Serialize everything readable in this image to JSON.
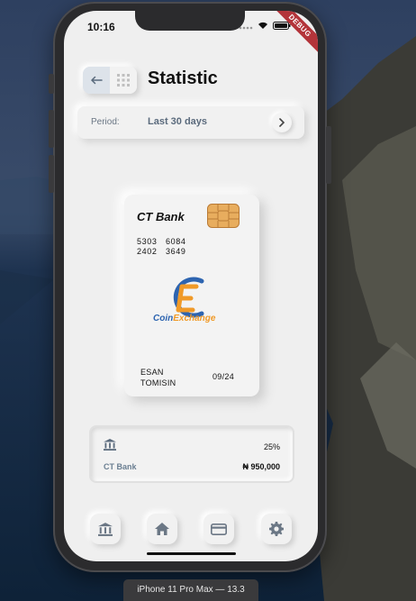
{
  "simulator": {
    "device_label": "iPhone 11 Pro Max — 13.3"
  },
  "status_bar": {
    "time": "10:16",
    "debug_banner": "DEBUG"
  },
  "header": {
    "title": "Statistic",
    "back_icon": "arrow-left-icon",
    "grid_icon": "grid-icon"
  },
  "period": {
    "label": "Period:",
    "value": "Last 30 days"
  },
  "card": {
    "bank_name": "CT Bank",
    "number_rows": [
      [
        "5303",
        "6084"
      ],
      [
        "2402",
        "3649"
      ]
    ],
    "logo_text_part1": "Coin",
    "logo_text_part2": "Exchange",
    "holder_line1": "ESAN",
    "holder_line2": "TOMISIN",
    "expiry": "09/24"
  },
  "summary": {
    "bank_name": "CT Bank",
    "percentage": "25%",
    "amount": "₦ 950,000"
  },
  "bottom_nav": {
    "items": [
      "bank-icon",
      "home-icon",
      "card-icon",
      "gear-icon"
    ]
  },
  "colors": {
    "screen_bg": "#efefef",
    "accent_blue": "#2d64b0",
    "accent_orange": "#f09a28",
    "muted_text": "#6b7f92",
    "debug_red": "#b3343a"
  }
}
